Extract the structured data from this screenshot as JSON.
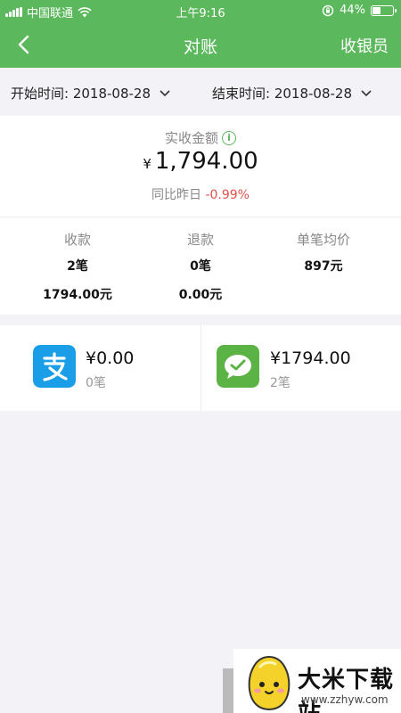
{
  "status": {
    "carrier": "中国联通",
    "time": "上午9:16",
    "battery": "44%",
    "battery_level": 0.44
  },
  "nav": {
    "title": "对账",
    "action": "收银员"
  },
  "dates": {
    "start": "开始时间: 2018-08-28",
    "end": "结束时间: 2018-08-28"
  },
  "summary": {
    "label": "实收金额",
    "currency": "¥",
    "amount": "1,794.00",
    "compare_label": "同比昨日",
    "compare_value": "-0.99%"
  },
  "stats": [
    {
      "header": "收款",
      "v1": "2笔",
      "v2": "1794.00元"
    },
    {
      "header": "退款",
      "v1": "0笔",
      "v2": "0.00元"
    },
    {
      "header": "单笔均价",
      "v1": "897元",
      "v2": ""
    }
  ],
  "payments": [
    {
      "name": "alipay-icon",
      "amount": "¥0.00",
      "count": "0笔",
      "color": "#1a9ee8"
    },
    {
      "name": "wechat-icon",
      "amount": "¥1794.00",
      "count": "2笔",
      "color": "#5bb346"
    }
  ],
  "watermark": {
    "text": "大米下载站",
    "url": "www.zzhyw.com"
  },
  "colors": {
    "brand": "#5cb85c",
    "negative": "#e0524c"
  }
}
